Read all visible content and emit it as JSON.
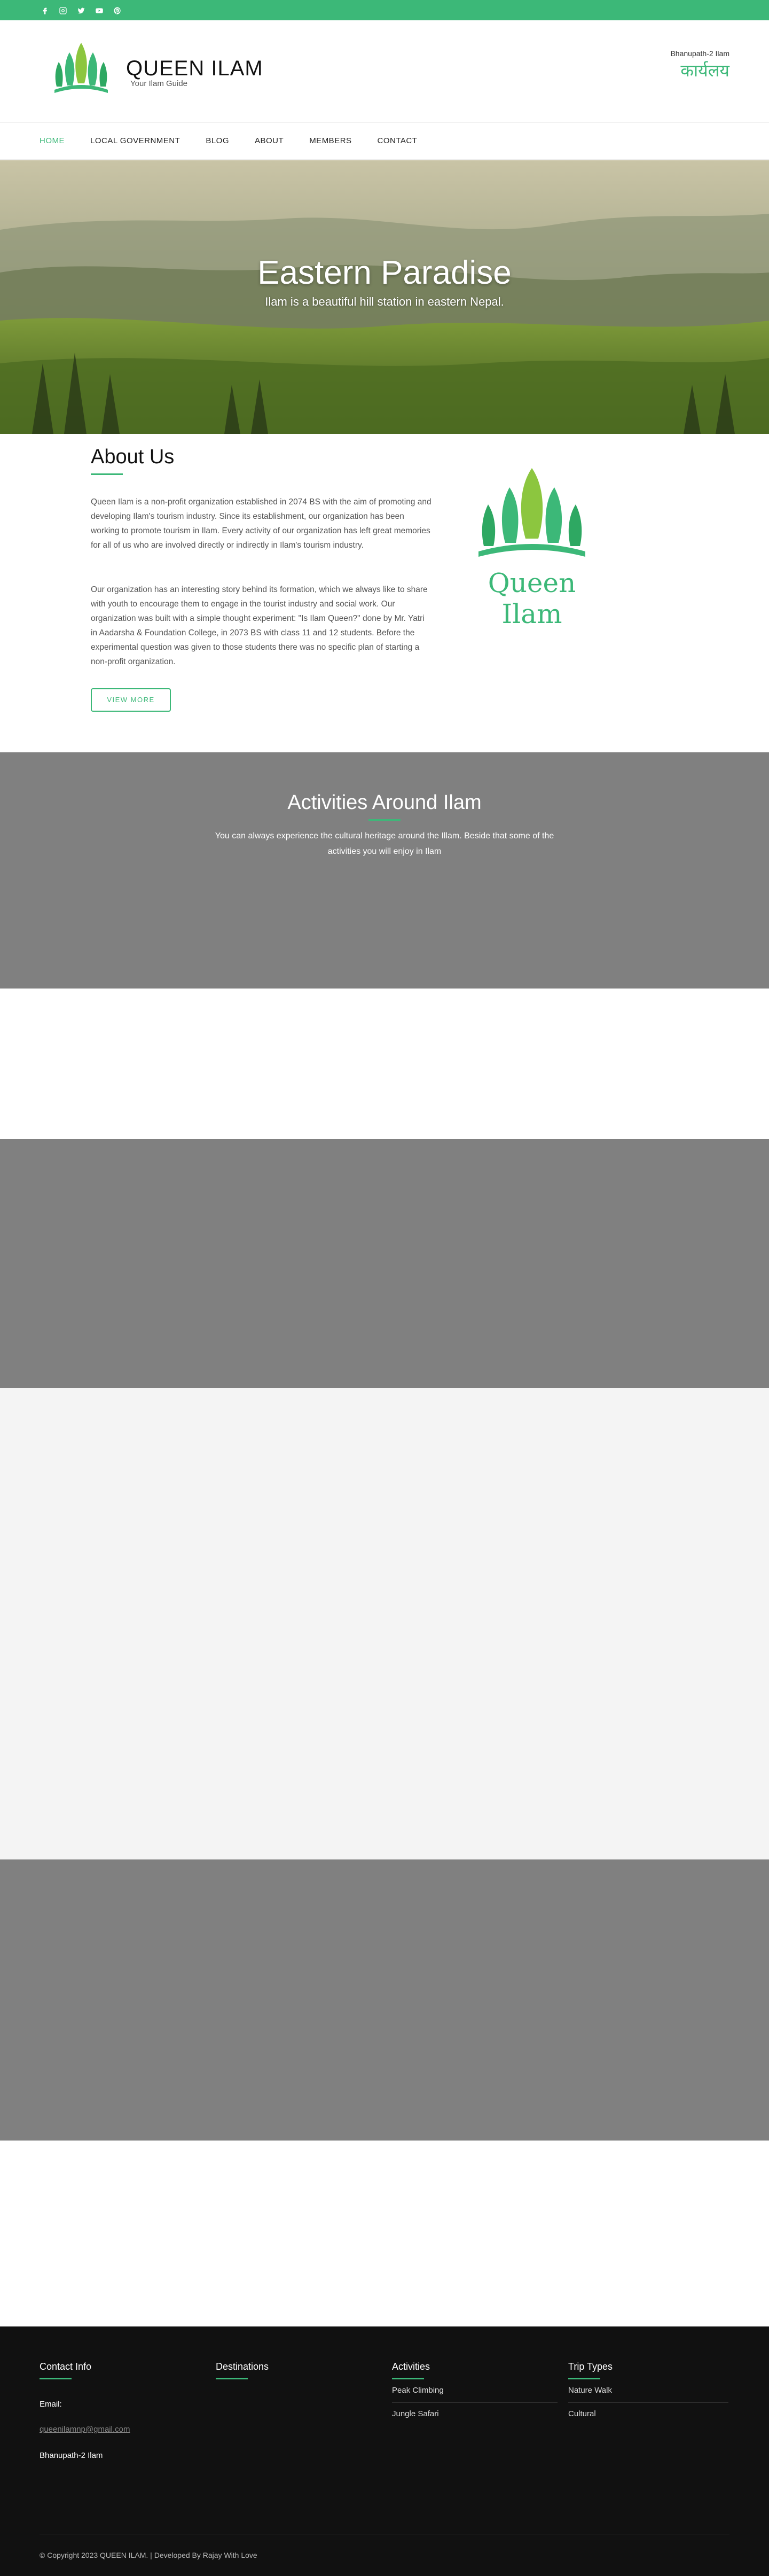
{
  "topbar": {
    "icons": [
      "facebook-icon",
      "instagram-icon",
      "twitter-icon",
      "youtube-icon",
      "pinterest-icon"
    ],
    "bg_color": "#3cb878"
  },
  "header": {
    "brand_title": "QUEEN ILAM",
    "brand_tagline": "Your Ilam Guide",
    "office_address": "Bhanupath-2 Ilam",
    "office_label": "कार्यलय"
  },
  "nav": {
    "items": [
      {
        "label": "HOME",
        "active": true
      },
      {
        "label": "LOCAL GOVERNMENT",
        "active": false
      },
      {
        "label": "BLOG",
        "active": false
      },
      {
        "label": "ABOUT",
        "active": false
      },
      {
        "label": "MEMBERS",
        "active": false
      },
      {
        "label": "CONTACT",
        "active": false
      }
    ]
  },
  "hero": {
    "title": "Eastern Paradise",
    "subtitle": "Ilam is a beautiful hill station in eastern Nepal."
  },
  "about": {
    "heading": "About Us",
    "paragraph_1": "Queen Ilam is a non-profit organization established in 2074 BS with the aim of promoting and developing Ilam's tourism industry. Since its establishment, our organization has been working to promote tourism in Ilam. Every activity of our organization has left great memories for all of us who are involved directly or indirectly in Ilam's tourism industry.",
    "paragraph_2": "Our organization has an interesting story behind its formation, which we always like to share with youth to encourage them to engage in the tourist industry and social work. Our organization was built with a simple thought experiment: \"Is Ilam Queen?\" done by Mr. Yatri in Aadarsha & Foundation College, in 2073 BS with class 11 and 12 students. Before the experimental question was given to those students there was no specific plan of starting a non-profit organization.",
    "button_label": "VIEW MORE",
    "logo_text": "Queen Ilam"
  },
  "activities": {
    "heading": "Activities Around Ilam",
    "description": "You can always experience the cultural heritage around the Illam. Beside that some of the activities you will enjoy in Ilam"
  },
  "footer": {
    "contact": {
      "heading": "Contact Info",
      "email_label": "Email:",
      "email": "queenilamnp@gmail.com",
      "address": "Bhanupath-2 Ilam"
    },
    "destinations": {
      "heading": "Destinations"
    },
    "activities": {
      "heading": "Activities",
      "items": [
        "Peak Climbing",
        "Jungle Safari"
      ]
    },
    "trip_types": {
      "heading": "Trip Types",
      "items": [
        "Nature Walk",
        "Cultural"
      ]
    },
    "copyright": "© Copyright 2023 QUEEN ILAM. | Developed By Rajay With Love"
  },
  "colors": {
    "accent": "#3cb878",
    "section_grey": "#808080",
    "footer_bg": "#111111"
  }
}
